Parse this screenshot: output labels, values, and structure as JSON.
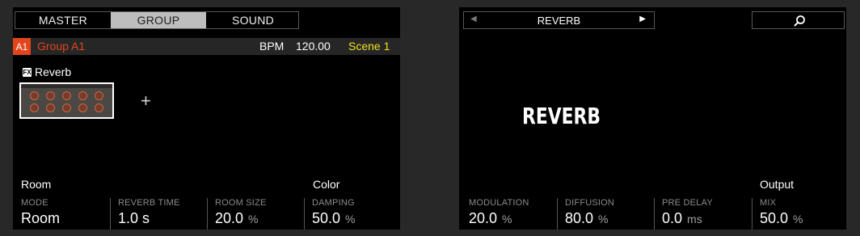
{
  "left": {
    "tabs": [
      {
        "label": "MASTER",
        "active": false
      },
      {
        "label": "GROUP",
        "active": true
      },
      {
        "label": "SOUND",
        "active": false
      }
    ],
    "group_bar": {
      "id": "A1",
      "name": "Group A1",
      "bpm_label": "BPM",
      "bpm_value": "120.00",
      "scene": "Scene 1"
    },
    "fx_slot": {
      "icon": "FX",
      "title": "Reverb",
      "add_icon": "+"
    },
    "sections": {
      "room": "Room",
      "color": "Color"
    },
    "params": [
      {
        "label": "MODE",
        "value": "Room",
        "unit": ""
      },
      {
        "label": "REVERB TIME",
        "value": "1.0 s",
        "unit": ""
      },
      {
        "label": "ROOM SIZE",
        "value": "20.0",
        "unit": "%"
      },
      {
        "label": "DAMPING",
        "value": "50.0",
        "unit": "%"
      }
    ]
  },
  "right": {
    "nav": {
      "prev_icon": "◀",
      "title": "REVERB",
      "next_icon": "▶"
    },
    "search_icon": "search-icon",
    "big_title": "REVERB",
    "sections": {
      "output": "Output"
    },
    "params": [
      {
        "label": "MODULATION",
        "value": "20.0",
        "unit": "%"
      },
      {
        "label": "DIFFUSION",
        "value": "80.0",
        "unit": "%"
      },
      {
        "label": "PRE DELAY",
        "value": "0.0",
        "unit": "ms"
      },
      {
        "label": "MIX",
        "value": "50.0",
        "unit": "%"
      }
    ]
  },
  "colors": {
    "accent_orange": "#e2451c",
    "scene_yellow": "#f2e21f",
    "active_tab": "#bdbdbd"
  }
}
